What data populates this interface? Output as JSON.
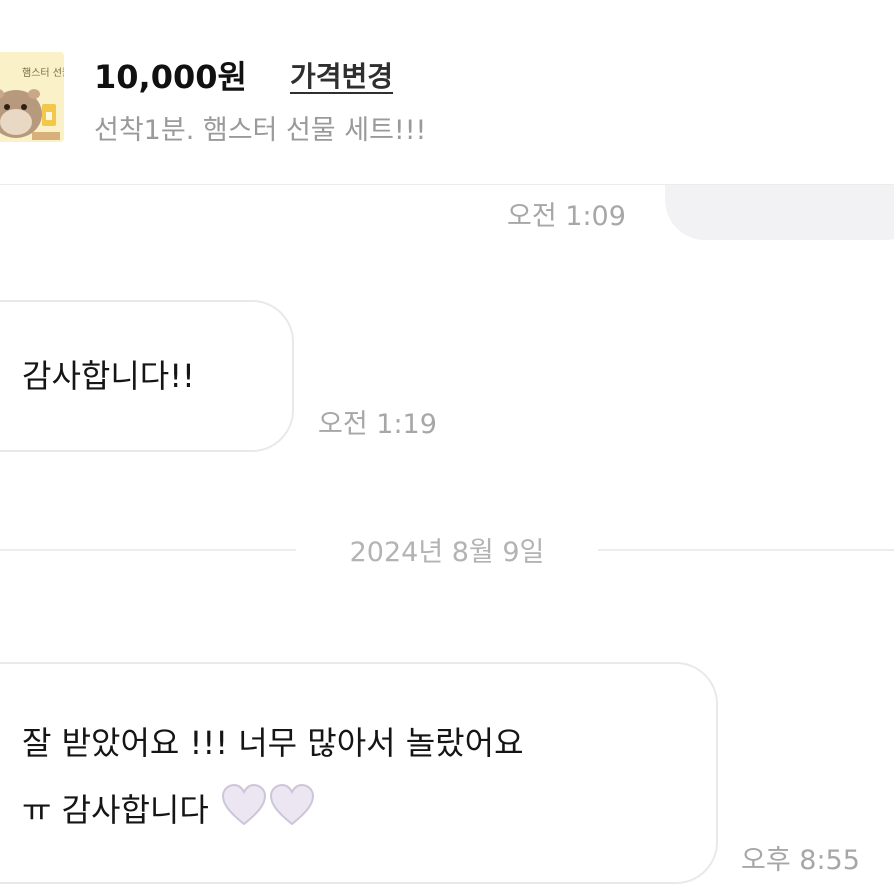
{
  "header": {
    "price": "10,000원",
    "price_change_label": "가격변경",
    "product_title": "선착1분. 햄스터 선물 세트!!!",
    "thumbnail_text": "햄스터 선물 세트"
  },
  "messages": [
    {
      "side": "outgoing",
      "text": "\" \"",
      "time": "오전 1:09"
    },
    {
      "side": "incoming",
      "text": "감사합니다!!",
      "time": "오전 1:19"
    },
    {
      "side": "date",
      "text": "2024년 8월 9일"
    },
    {
      "side": "incoming",
      "line1": "잘 받았어요 !!! 너무 많아서 놀랐어요",
      "line2": "ㅠ 감사합니다",
      "time": "오후 8:55",
      "emoji": "white-heart-icon"
    }
  ],
  "colors": {
    "bubble_border": "#e9e9ec",
    "time_text": "#a7a7a7",
    "outgoing_bubble": "#f2f2f4",
    "heart_fill": "#ebe6f2"
  }
}
